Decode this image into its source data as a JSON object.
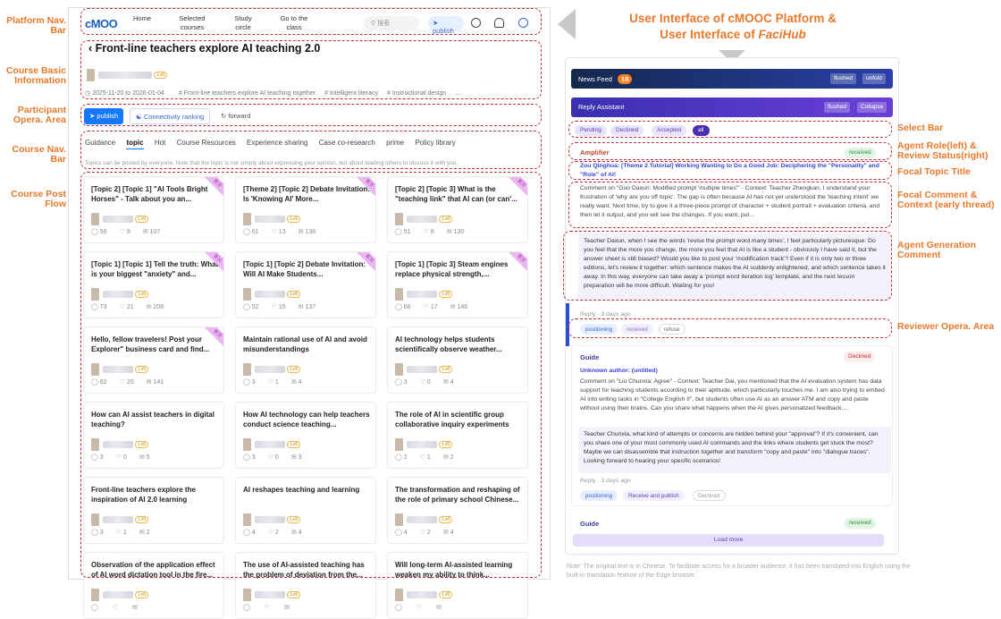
{
  "header": {
    "line1": "User Interface of cMOOC Platform &",
    "line2_prefix": "User Interface of ",
    "line2_italic": "FaciHub"
  },
  "left_labels": [
    "Platform Nav. Bar",
    "Course Basic Information",
    "Participant Opera. Area",
    "Course Nav. Bar",
    "Course Post Flow"
  ],
  "right_labels": [
    "Select Bar",
    "Agent Role(left) & Review Status(right)",
    "Focal Topic Title",
    "Focal Comment & Context (early thread)",
    "Agent Generation Comment",
    "Reviewer Opera.  Area"
  ],
  "nav": {
    "logo": "cMOO",
    "items": [
      "Home",
      "Selected courses",
      "Study circle",
      "Go to the class"
    ],
    "search": "搜索",
    "publish": "publish"
  },
  "course": {
    "title": "Front-line teachers explore AI teaching 2.0",
    "dates": "2025-11-20 to 2026-01-04",
    "tags": [
      "# Front-line teachers explore AI teaching together",
      "# Intelligent literacy",
      "# Instructional design",
      "..."
    ],
    "chip": "Lv6"
  },
  "ops": {
    "publish": "publish",
    "ranking": "Connectivity ranking",
    "forward": "forward"
  },
  "tabs": [
    "Guidance",
    "topic",
    "Hot",
    "Course Resources",
    "Experience sharing",
    "Case co-research",
    "prime",
    "Policy library"
  ],
  "hint": "Topics can be posted by everyone. Note that the topic is not simply about expressing your opinion, but about leading others to discuss it with you.",
  "ribbon_label": "置顶",
  "cards": [
    {
      "title": "[Topic 2]  [Topic 1] \"AI Tools Bright Horses\" - Talk about you an...",
      "c": "56",
      "l": "9",
      "v": "107",
      "pin": true
    },
    {
      "title": "[Theme 2]  [Topic 2] Debate Invitation: Is 'Knowing AI' More...",
      "c": "61",
      "l": "13",
      "v": "136",
      "pin": true
    },
    {
      "title": "[Topic 2]  [Topic 3] What is the \"teaching link\" that AI can (or can'...",
      "c": "51",
      "l": "8",
      "v": "130",
      "pin": true
    },
    {
      "title": "[Topic 1]  [Topic 1] Tell the truth: What is your biggest \"anxiety\" and...",
      "c": "73",
      "l": "21",
      "v": "208",
      "pin": true
    },
    {
      "title": "[Topic 1]  [Topic 2] Debate Invitation: Will AI Make Students...",
      "c": "52",
      "l": "15",
      "v": "137",
      "pin": true
    },
    {
      "title": "[Topic 1]  [Topic 3] Steam engines replace physical strength,...",
      "c": "66",
      "l": "17",
      "v": "146",
      "pin": true
    },
    {
      "title": "Hello, fellow travelers! Post your Explorer\" business card and find...",
      "c": "62",
      "l": "20",
      "v": "141",
      "pin": true
    },
    {
      "title": "Maintain rational use of AI and avoid misunderstandings",
      "c": "3",
      "l": "1",
      "v": "4",
      "pin": false
    },
    {
      "title": "AI technology helps students scientifically observe weather...",
      "c": "3",
      "l": "0",
      "v": "4",
      "pin": false
    },
    {
      "title": "How can AI assist teachers in digital teaching?",
      "c": "3",
      "l": "0",
      "v": "5",
      "pin": false
    },
    {
      "title": "How AI technology can help teachers conduct science teaching...",
      "c": "3",
      "l": "0",
      "v": "3",
      "pin": false
    },
    {
      "title": "The role of AI in scientific group collaborative inquiry experiments",
      "c": "2",
      "l": "1",
      "v": "2",
      "pin": false
    },
    {
      "title": "Front-line teachers explore the inspiration of AI 2.0 learning",
      "c": "3",
      "l": "1",
      "v": "2",
      "pin": false
    },
    {
      "title": "AI reshapes teaching and learning",
      "c": "4",
      "l": "2",
      "v": "4",
      "pin": false
    },
    {
      "title": "The transformation and reshaping of the role of primary school Chinese...",
      "c": "4",
      "l": "2",
      "v": "4",
      "pin": false
    },
    {
      "title": "Observation of the application effect of AI word dictation tool in the fire...",
      "c": "",
      "l": "",
      "v": "",
      "pin": false
    },
    {
      "title": "The use of AI-assisted teaching has the problem of deviation from the...",
      "c": "",
      "l": "",
      "v": "",
      "pin": false
    },
    {
      "title": "Will long-term AI-assisted learning weaken my ability to think...",
      "c": "",
      "l": "",
      "v": "",
      "pin": false
    }
  ],
  "faci": {
    "news_feed": "News Feed",
    "news_count": "18",
    "flushed": "flushed",
    "unfold": "unfold",
    "reply_assistant": "Reply Assistant",
    "collapse": "Collapse",
    "filters": [
      "Pending",
      "Declined",
      "Accepted",
      "all"
    ],
    "item1": {
      "role": "Amplifier",
      "status": "received",
      "topic": "Zou Qinghua: [Theme 2 Tutorial] Working Wanting to Do a Good Job: Deciphering the \"Personality\" and \"Role\" of AI!",
      "context": "Comment on \"Guo Daxun: Modified prompt 'multiple times'\" - Context: Teacher Zhengkan, I understand your frustration of 'why are you off topic'. The gap is often because AI has not yet understood the 'teaching intent' we really want. Next time, try to give it a three-piece prompt of character + student portrait + evaluation criteria, and then let it output, and you will see the changes. If you want, put...",
      "gen": "Teacher Daxun, when I see the words 'revise the prompt word many times', I feel particularly picturesque: Do you feel that the more you change, the more you feel that AI is like a student - obviously I have said it, but the answer sheet is still biased? Would you like to post your 'modification track'? Even if it is only two or three editions, let's review it together: which sentence makes the AI suddenly enlightened, and which sentence takes it away. In this way, everyone can take away a 'prompt word iteration log' template, and the next lesson preparation will be more difficult. Waiting for you!",
      "time": "Reply · 3 days ago",
      "btns": [
        "positioning",
        "received",
        "refuse"
      ]
    },
    "item2": {
      "role": "Guide",
      "status": "Declined",
      "author": "Unknown author: (untitled)",
      "context": "Comment on \"Liu Chunxia: Agree\" - Context: Teacher Dai, you mentioned that the AI evaluation system has data support for teaching students according to their aptitude, which particularly touches me. I am also trying to embed AI into writing tasks in \"College English II\", but students often use AI as an answer ATM and copy and paste without using their brains. Can you share what happens when the AI gives personalized feedback,...",
      "gen": "Teacher Chunxia, what kind of attempts or concerns are hidden behind your \"approval\"? If it's convenient, can you share one of your most commonly used AI commands and the links where students get stuck the most? Maybe we can disassemble that instruction together and transform \"copy and paste\" into \"dialogue traces\". Looking forward to hearing your specific scenarios!",
      "time": "Reply · 3 days ago",
      "btns": [
        "positioning",
        "Receive and publish",
        "Declined"
      ]
    },
    "item3": {
      "role": "Guide",
      "status": "received"
    },
    "load_more": "Load more"
  },
  "note": {
    "label": "Note:",
    "text": " The original text is in Chinese. To facilitate access for a broader audience, it has been translated into English using the built-in translation feature of the Edge browser."
  }
}
